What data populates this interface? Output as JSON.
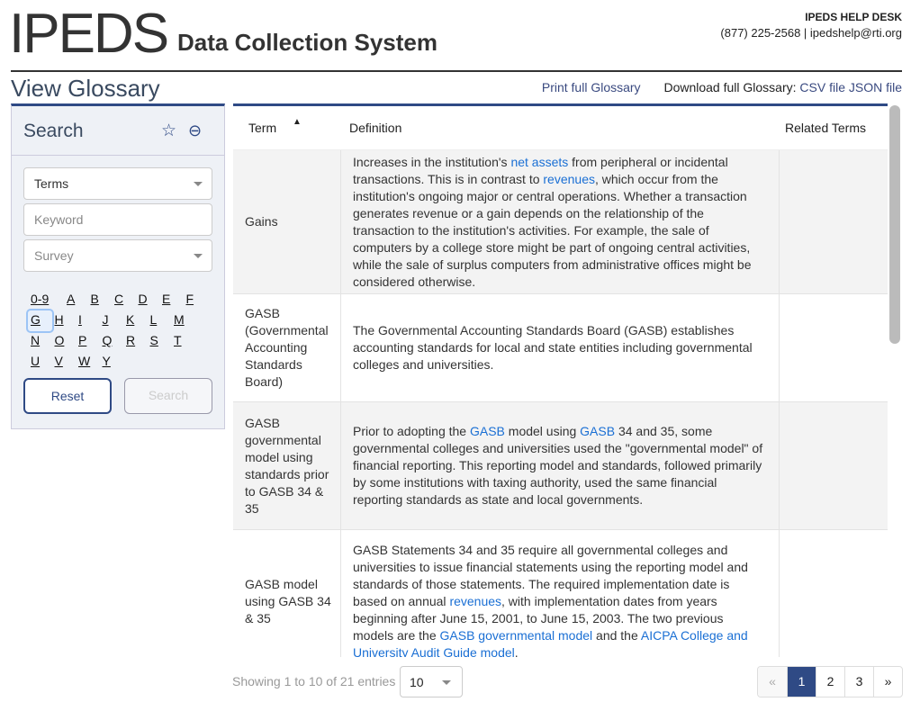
{
  "header": {
    "logo": "IPEDS",
    "subtitle": "Data Collection System",
    "help_title": "IPEDS HELP DESK",
    "help_contact": "(877) 225-2568 | ipedshelp@rti.org"
  },
  "page": {
    "title": "View Glossary",
    "print": "Print full Glossary",
    "download_label": "Download full Glossary:",
    "csv": "CSV file",
    "json": "JSON file"
  },
  "sidebar": {
    "title": "Search",
    "type_select": "Terms",
    "keyword_placeholder": "Keyword",
    "survey_placeholder": "Survey",
    "letters": [
      "0-9",
      "A",
      "B",
      "C",
      "D",
      "E",
      "F",
      "G",
      "H",
      "I",
      "J",
      "K",
      "L",
      "M",
      "N",
      "O",
      "P",
      "Q",
      "R",
      "S",
      "T",
      "U",
      "V",
      "W",
      "Y"
    ],
    "selected_letter": "G",
    "reset": "Reset",
    "search": "Search"
  },
  "table": {
    "headers": {
      "term": "Term",
      "definition": "Definition",
      "related": "Related Terms"
    },
    "rows": [
      {
        "term": "Gains",
        "definition": [
          {
            "t": "Increases in the institution's "
          },
          {
            "t": "net assets",
            "link": true
          },
          {
            "t": " from peripheral or incidental transactions. This is in contrast to "
          },
          {
            "t": "revenues",
            "link": true
          },
          {
            "t": ", which occur from the institution's ongoing major or central operations. Whether a transaction generates revenue or a gain depends on the relationship of the transaction to the institution's activities. For example, the sale of computers by a college store might be part of ongoing central activities, while the sale of surplus computers from administrative offices might be considered otherwise."
          }
        ],
        "related": ""
      },
      {
        "term": "GASB (Governmental Accounting Standards Board)",
        "definition": [
          {
            "t": "The Governmental Accounting Standards Board (GASB) establishes accounting standards for local and state entities including governmental colleges and universities."
          }
        ],
        "related": ""
      },
      {
        "term": "GASB governmental model using standards prior to GASB 34 & 35",
        "definition": [
          {
            "t": "Prior to adopting the "
          },
          {
            "t": "GASB",
            "link": true
          },
          {
            "t": " model using "
          },
          {
            "t": "GASB",
            "link": true
          },
          {
            "t": " 34 and 35, some governmental colleges and universities used the \"governmental model\" of financial reporting. This reporting model and standards, followed primarily by some institutions with taxing authority, used the same financial reporting standards as state and local governments."
          }
        ],
        "related": ""
      },
      {
        "term": "GASB model using GASB 34 & 35",
        "definition": [
          {
            "t": "GASB Statements 34 and 35 require all governmental colleges and universities to issue financial statements using the reporting model and standards of those statements. The required implementation date is based on annual "
          },
          {
            "t": "revenues",
            "link": true
          },
          {
            "t": ", with implementation dates from years beginning after June 15, 2001, to June 15, 2003. The two previous models are the "
          },
          {
            "t": "GASB governmental model",
            "link": true
          },
          {
            "t": " and the "
          },
          {
            "t": "AICPA College and University Audit Guide model",
            "link": true
          },
          {
            "t": "."
          }
        ],
        "related": ""
      }
    ]
  },
  "footer": {
    "info": "Showing 1 to 10 of 21 entries",
    "page_length": "10",
    "pages": [
      "«",
      "1",
      "2",
      "3",
      "»"
    ],
    "current_page": "1"
  }
}
